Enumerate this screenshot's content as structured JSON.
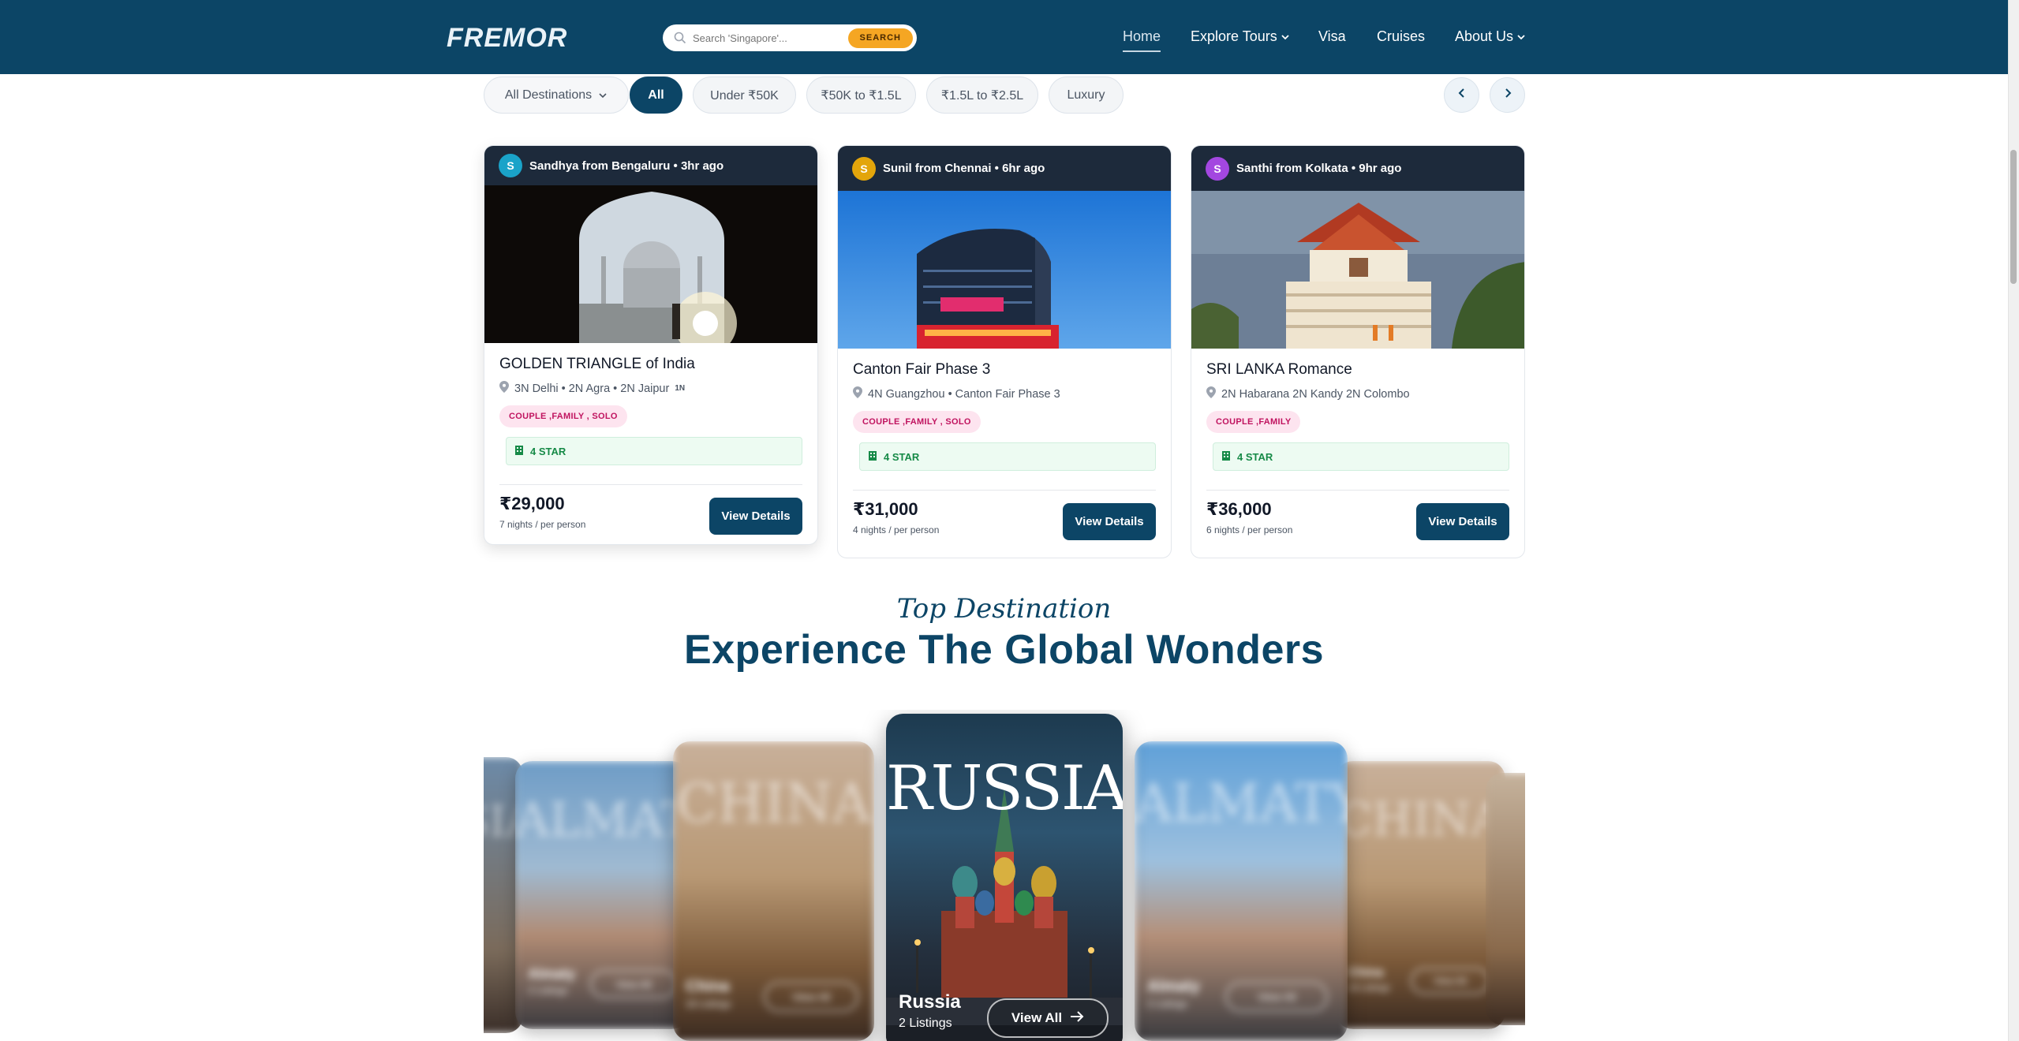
{
  "header": {
    "logo": "FREMOR",
    "search_placeholder": "Search 'Singapore'...",
    "search_button": "SEARCH",
    "nav": [
      {
        "label": "Home",
        "active": true
      },
      {
        "label": "Explore Tours",
        "dropdown": true
      },
      {
        "label": "Visa"
      },
      {
        "label": "Cruises"
      },
      {
        "label": "About Us",
        "dropdown": true
      }
    ]
  },
  "filters": {
    "destinations_select": "All Destinations",
    "pills": [
      "All",
      "Under ₹50K",
      "₹50K to ₹1.5L",
      "₹1.5L to ₹2.5L",
      "Luxury"
    ],
    "active_pill": "All"
  },
  "cards": [
    {
      "avatar": "S",
      "avatar_color": "#1aa3c9",
      "booked_by": "Sandhya from Bengaluru • 3hr ago",
      "title": "GOLDEN TRIANGLE of India",
      "route": "3N Delhi • 2N Agra • 2N Jaipur",
      "route_suffix": "1N",
      "tags": "COUPLE ,FAMILY , SOLO",
      "hotel": "4 STAR",
      "price": "₹29,000",
      "price_note": "7 nights / per person",
      "button": "View Details"
    },
    {
      "avatar": "S",
      "avatar_color": "#e3a50b",
      "booked_by": "Sunil from Chennai • 6hr ago",
      "title": "Canton Fair Phase 3",
      "route": "4N Guangzhou • Canton Fair Phase 3",
      "tags": "COUPLE ,FAMILY , SOLO",
      "hotel": "4 STAR",
      "price": "₹31,000",
      "price_note": "4 nights / per person",
      "button": "View Details"
    },
    {
      "avatar": "S",
      "avatar_color": "#a347e0",
      "booked_by": "Santhi from Kolkata • 9hr ago",
      "title": "SRI LANKA Romance",
      "route": "2N Habarana 2N Kandy 2N Colombo",
      "tags": "COUPLE ,FAMILY",
      "hotel": "4 STAR",
      "price": "₹36,000",
      "price_note": "6 nights / per person",
      "button": "View Details"
    }
  ],
  "destinations": {
    "script_title": "Top Destination",
    "title": "Experience The Global Wonders",
    "featured": {
      "name_art": "RUSSIA",
      "name": "Russia",
      "listings": "2 Listings",
      "button": "View All"
    },
    "side": [
      {
        "name_art": "SIA"
      },
      {
        "name_art": "ALMATY",
        "name": "Almaty",
        "listings": "2 Listings",
        "button": "View All"
      },
      {
        "name_art": "CHINA",
        "name": "China",
        "listings": "18 Listings",
        "button": "View All"
      },
      {
        "name_art": "ALMATY",
        "name": "Almaty",
        "listings": "2 Listings",
        "button": "View All"
      },
      {
        "name_art": "CHINA",
        "name": "China",
        "listings": "18 Listings",
        "button": "View All"
      }
    ]
  }
}
